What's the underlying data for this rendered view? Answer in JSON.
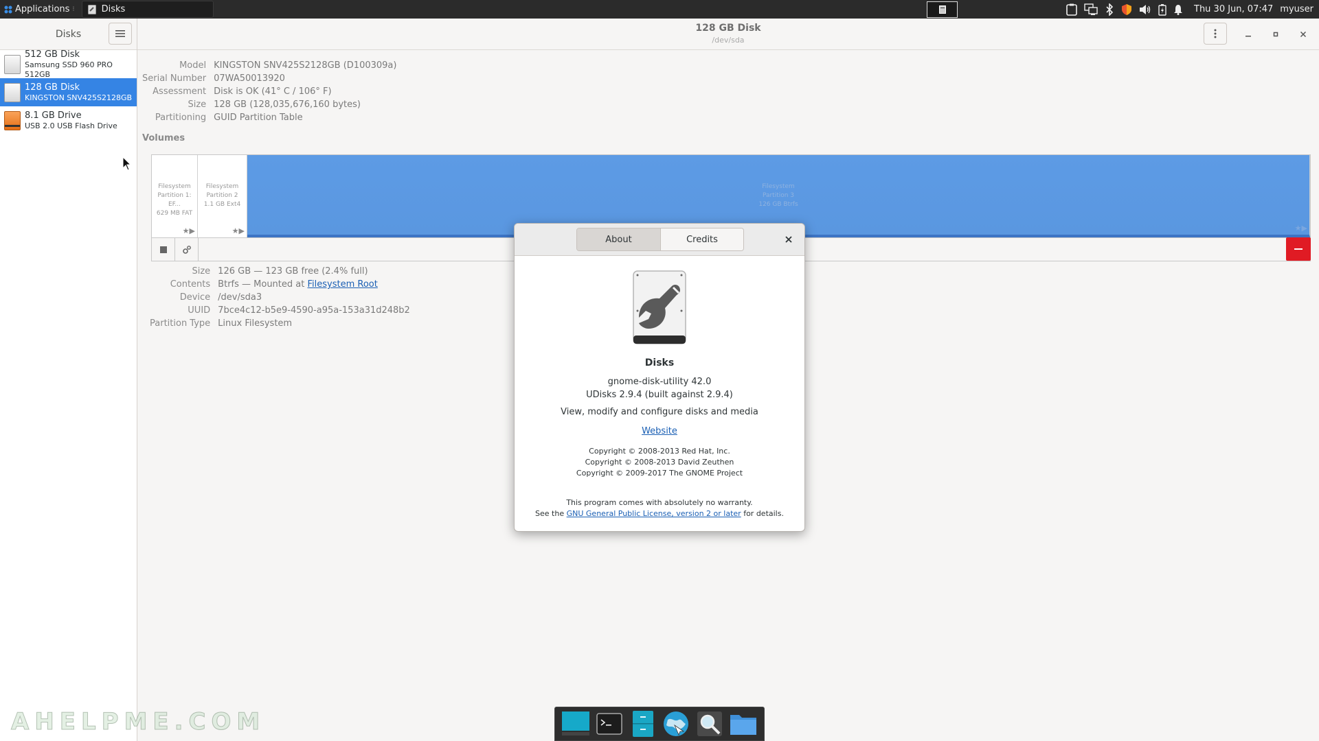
{
  "top_panel": {
    "applications_label": "Applications",
    "task_title": "Disks",
    "clock": "Thu 30 Jun, 07:47",
    "username": "myuser"
  },
  "sidebar": {
    "title": "Disks",
    "disks": [
      {
        "name": "512 GB Disk",
        "sub": "Samsung SSD 960 PRO 512GB",
        "icon": "hdd-icon",
        "selected": false
      },
      {
        "name": "128 GB Disk",
        "sub": "KINGSTON SNV425S2128GB",
        "icon": "hdd-icon",
        "selected": true
      },
      {
        "name": "8.1 GB Drive",
        "sub": "USB 2.0 USB Flash Drive",
        "icon": "usb-drive-icon",
        "selected": false
      }
    ]
  },
  "header": {
    "title": "128 GB Disk",
    "subtitle": "/dev/sda"
  },
  "disk_info": {
    "model_label": "Model",
    "model": "KINGSTON SNV425S2128GB (D100309a)",
    "serial_label": "Serial Number",
    "serial": "07WA50013920",
    "assessment_label": "Assessment",
    "assessment": "Disk is OK (41° C / 106° F)",
    "size_label": "Size",
    "size": "128 GB (128,035,676,160 bytes)",
    "partitioning_label": "Partitioning",
    "partitioning": "GUID Partition Table"
  },
  "volumes": {
    "title": "Volumes",
    "partitions": [
      {
        "l1": "Filesystem",
        "l2": "Partition 1: EF...",
        "l3": "629 MB FAT"
      },
      {
        "l1": "Filesystem",
        "l2": "Partition 2",
        "l3": "1.1 GB Ext4"
      },
      {
        "l1": "Filesystem",
        "l2": "Partition 3",
        "l3": "126 GB Btrfs"
      }
    ]
  },
  "volume_info": {
    "size_label": "Size",
    "size": "126 GB — 123 GB free (2.4% full)",
    "contents_label": "Contents",
    "contents_prefix": "Btrfs — Mounted at ",
    "contents_link": "Filesystem Root",
    "device_label": "Device",
    "device": "/dev/sda3",
    "uuid_label": "UUID",
    "uuid": "7bce4c12-b5e9-4590-a95a-153a31d248b2",
    "ptype_label": "Partition Type",
    "ptype": "Linux Filesystem"
  },
  "about": {
    "tab_about": "About",
    "tab_credits": "Credits",
    "app_name": "Disks",
    "version": "gnome-disk-utility 42.0",
    "udisks": "UDisks 2.9.4 (built against 2.9.4)",
    "description": "View, modify and configure disks and media",
    "website": "Website",
    "copyright": [
      "Copyright © 2008-2013 Red Hat, Inc.",
      "Copyright © 2008-2013 David Zeuthen",
      "Copyright © 2009-2017 The GNOME Project"
    ],
    "warranty": "This program comes with absolutely no warranty.",
    "license_prefix": "See the ",
    "license_link": "GNU General Public License, version 2 or later",
    "license_suffix": " for details."
  },
  "watermark": "AHELPME.COM",
  "colors": {
    "accent": "#3584e4",
    "partition_fill": "#5d9be5",
    "destructive": "#e01b24",
    "link": "#1a5fb4"
  }
}
